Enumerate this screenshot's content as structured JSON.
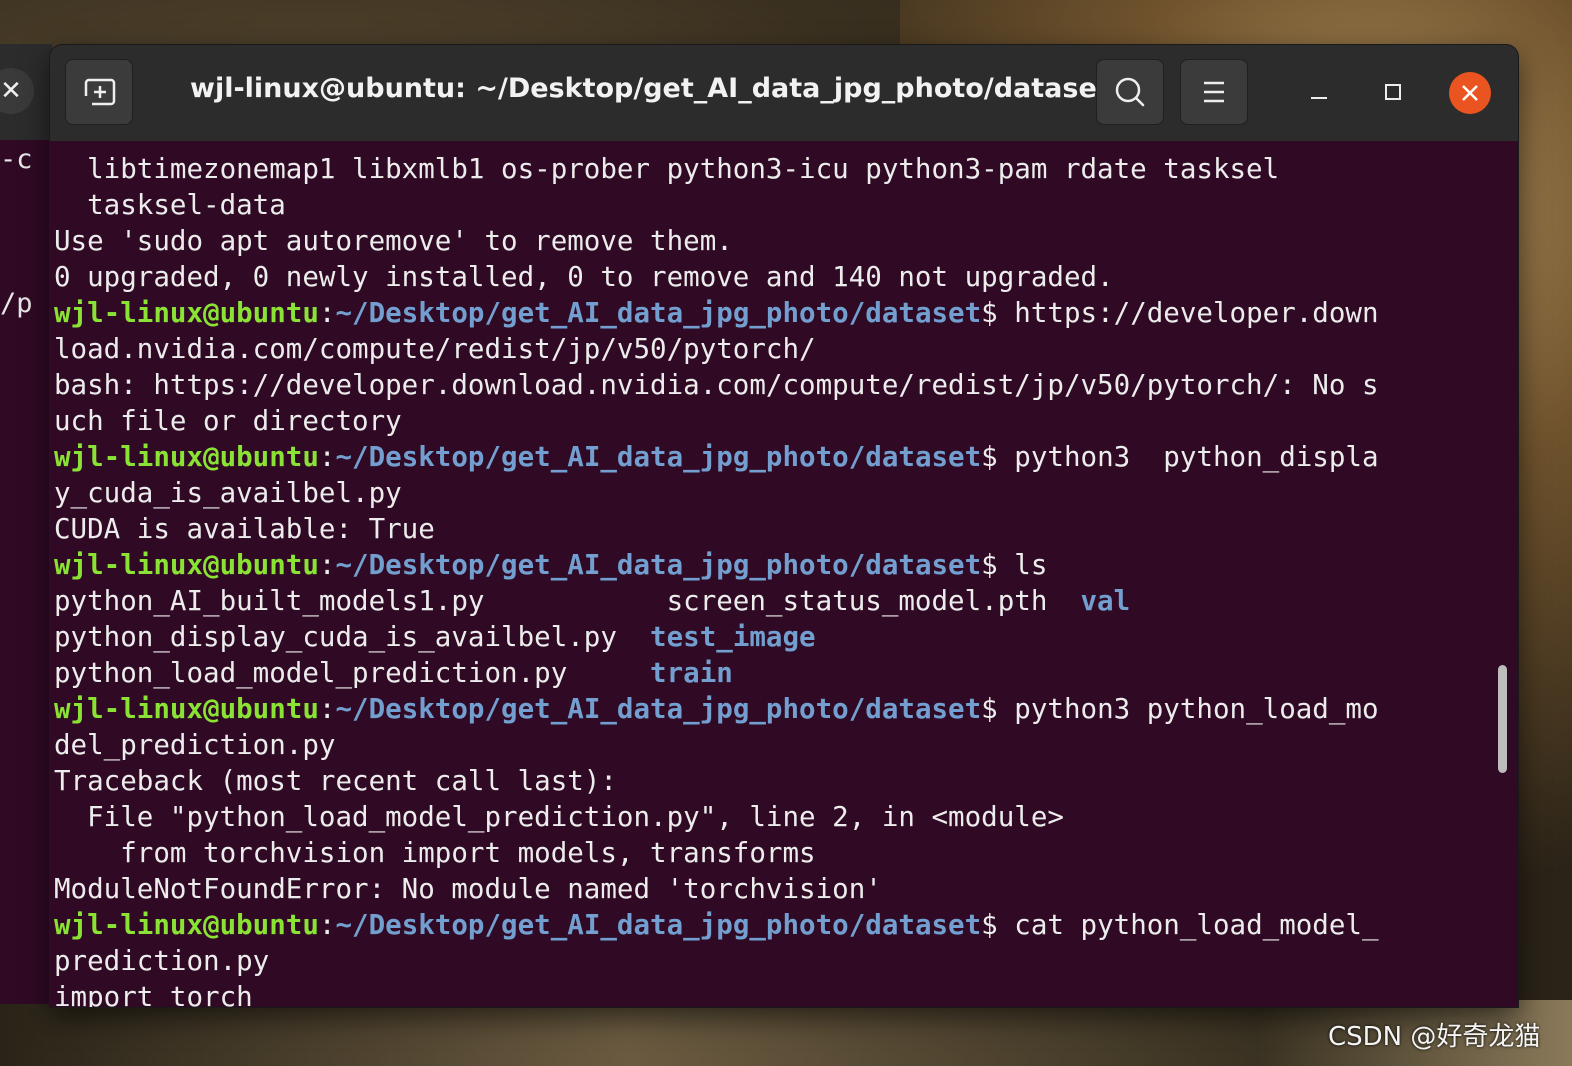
{
  "window": {
    "title": "wjl-linux@ubuntu: ~/Desktop/get_AI_data_jpg_photo/dataset"
  },
  "back_window": {
    "fragments": [
      "-c",
      "/p"
    ]
  },
  "prompt": {
    "user": "wjl-linux@ubuntu",
    "sep": ":",
    "path": "~/Desktop/get_AI_data_jpg_photo/dataset",
    "dollar": "$ "
  },
  "lines": {
    "l1": "  libtimezonemap1 libxmlb1 os-prober python3-icu python3-pam rdate tasksel",
    "l2": "  tasksel-data",
    "l3": "Use 'sudo apt autoremove' to remove them.",
    "l4": "0 upgraded, 0 newly installed, 0 to remove and 140 not upgraded.",
    "l5_cmd": "https://developer.down",
    "l6": "load.nvidia.com/compute/redist/jp/v50/pytorch/",
    "l7": "bash: https://developer.download.nvidia.com/compute/redist/jp/v50/pytorch/: No s",
    "l8": "uch file or directory",
    "l9_cmd": "python3  python_displa",
    "l10": "y_cuda_is_availbel.py",
    "l11": "CUDA is available: True",
    "l12_cmd": "ls",
    "l13_a": "python_AI_built_models1.py           screen_status_model.pth  ",
    "l13_b": "val",
    "l14_a": "python_display_cuda_is_availbel.py  ",
    "l14_b": "test_image",
    "l15_a": "python_load_model_prediction.py     ",
    "l15_b": "train",
    "l16_cmd": "python3 python_load_mo",
    "l17": "del_prediction.py",
    "l18": "Traceback (most recent call last):",
    "l19": "  File \"python_load_model_prediction.py\", line 2, in <module>",
    "l20": "    from torchvision import models, transforms",
    "l21": "ModuleNotFoundError: No module named 'torchvision'",
    "l22_cmd": "cat python_load_model_",
    "l23": "prediction.py",
    "l24": "import torch"
  },
  "watermark": "CSDN @好奇龙猫"
}
